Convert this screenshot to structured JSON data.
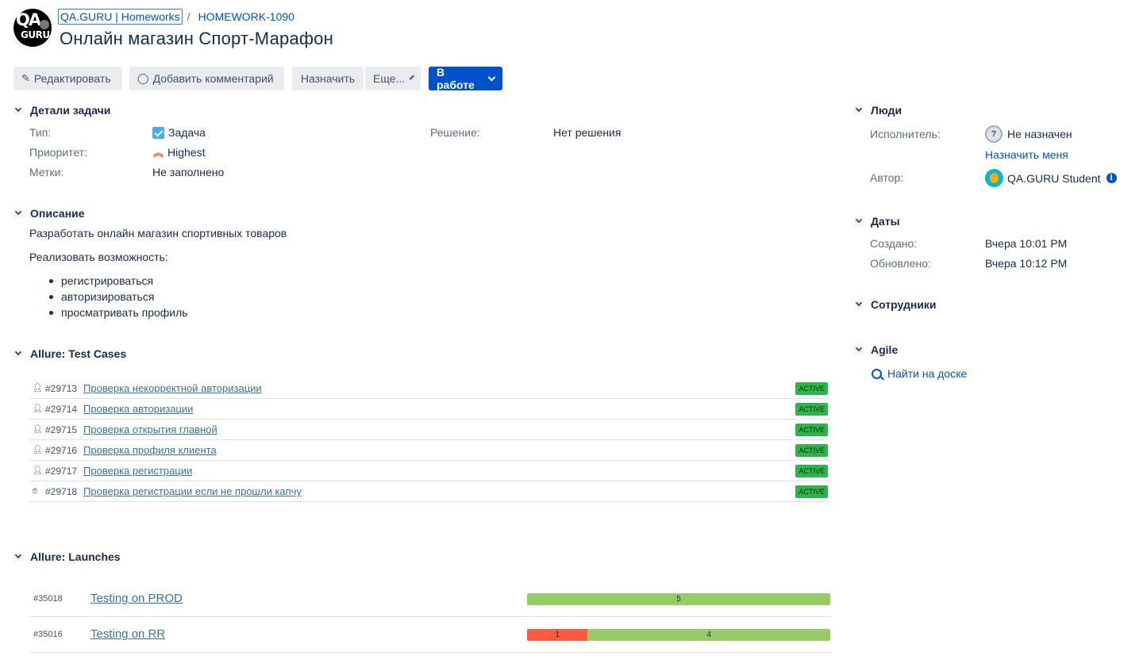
{
  "breadcrumb": {
    "project": "QA.GURU | Homeworks",
    "separator": "/",
    "issue_key": "HOMEWORK-1090"
  },
  "issue": {
    "title": "Онлайн магазин Спорт-Марафон"
  },
  "toolbar": {
    "edit": "Редактировать",
    "comment": "Добавить комментарий",
    "assign": "Назначить",
    "more": "Еще...",
    "status": "В работе"
  },
  "details": {
    "heading": "Детали задачи",
    "type_label": "Тип:",
    "type_value": "Задача",
    "priority_label": "Приоритет:",
    "priority_value": "Highest",
    "labels_label": "Метки:",
    "labels_value": "Не заполнено",
    "resolution_label": "Решение:",
    "resolution_value": "Нет решения"
  },
  "description": {
    "heading": "Описание",
    "line1": "Разработать онлайн магазин спортивных товаров",
    "line2": "Реализовать возможность:",
    "bullets": [
      "регистрироваться",
      "авторизироваться",
      "просматривать профиль"
    ]
  },
  "test_cases": {
    "heading": "Allure: Test Cases",
    "items": [
      {
        "id": "#29713",
        "name": "Проверка некорректной авторизации",
        "status": "ACTIVE"
      },
      {
        "id": "#29714",
        "name": "Проверка авторизации",
        "status": "ACTIVE"
      },
      {
        "id": "#29715",
        "name": "Проверка открытия главной",
        "status": "ACTIVE"
      },
      {
        "id": "#29716",
        "name": "Проверка профиля клиента",
        "status": "ACTIVE"
      },
      {
        "id": "#29717",
        "name": "Проверка регистрации",
        "status": "ACTIVE"
      },
      {
        "id": "#29718",
        "name": "Проверка регистрации если не прошли капчу",
        "status": "ACTIVE"
      }
    ]
  },
  "launches": {
    "heading": "Allure: Launches",
    "items": [
      {
        "id": "#35018",
        "name": "Testing on PROD",
        "failed": 0,
        "passed": 5
      },
      {
        "id": "#35016",
        "name": "Testing on RR",
        "failed": 1,
        "passed": 4
      }
    ]
  },
  "people": {
    "heading": "Люди",
    "assignee_label": "Исполнитель:",
    "assignee_value": "Не назначен",
    "assign_me": "Назначить меня",
    "author_label": "Автор:",
    "author_value": "QA.GURU Student"
  },
  "dates": {
    "heading": "Даты",
    "created_label": "Создано:",
    "created_value": "Вчера 10:01 PM",
    "updated_label": "Обновлено:",
    "updated_value": "Вчера 10:12 PM"
  },
  "staff": {
    "heading": "Сотрудники"
  },
  "agile": {
    "heading": "Agile",
    "find": "Найти на доске"
  },
  "colors": {
    "primary": "#0052cc",
    "active_badge": "#2db44a",
    "passed": "#97cc64",
    "failed": "#fd5a3e"
  }
}
